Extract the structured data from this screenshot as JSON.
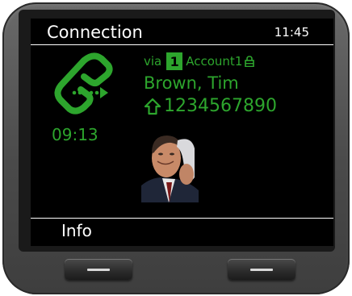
{
  "header": {
    "title": "Connection",
    "time": "11:45"
  },
  "call": {
    "via_label": "via",
    "account_number": "1",
    "account_name": "Account1",
    "caller_name": "Brown, Tim",
    "caller_number": "1234567890",
    "duration": "09:13"
  },
  "softkeys": {
    "left_label": "Info"
  },
  "icons": {
    "call_state": "outgoing-call-icon",
    "lock": "lock-icon",
    "number_type": "home-icon",
    "photo": "caller-photo"
  },
  "colors": {
    "accent": "#2da52d",
    "screen_background": "#000000",
    "text": "#ffffff"
  }
}
